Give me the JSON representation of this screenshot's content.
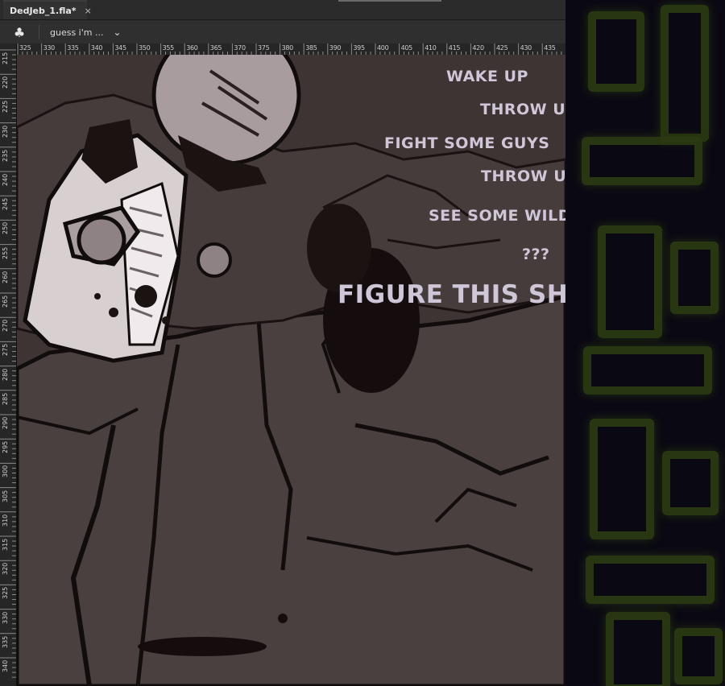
{
  "tab": {
    "title": "DedJeb_1.fla*",
    "close": "×"
  },
  "toolbar": {
    "scene_icon": "♣",
    "scene_name": "guess i'm ...",
    "chevron": "⌄"
  },
  "ruler": {
    "horizontal": [
      "325",
      "330",
      "335",
      "340",
      "345",
      "350",
      "355",
      "360",
      "365",
      "370",
      "375",
      "380",
      "385",
      "390",
      "395",
      "400",
      "405",
      "410",
      "415",
      "420",
      "425",
      "430",
      "435"
    ],
    "vertical": [
      "215",
      "220",
      "225",
      "230",
      "235",
      "240",
      "245",
      "250",
      "255",
      "260",
      "265",
      "270",
      "275",
      "280",
      "285",
      "290",
      "295",
      "300",
      "305",
      "310",
      "315",
      "320",
      "325",
      "330",
      "335",
      "340"
    ]
  },
  "stage_text": {
    "line1": "WAKE UP",
    "line2": "THROW UP",
    "line3": "FIGHT SOME GUYS",
    "line4": "THROW UP SOME MORE",
    "line5": "SEE SOME WILD SHIT",
    "line6": "???",
    "line7": "FIGURE THIS SHIT OUT"
  },
  "colors": {
    "stage_bg": "#3e3433",
    "text": "#cfc6d8",
    "panel": "#0a0813",
    "glow": "#2c3b12"
  }
}
